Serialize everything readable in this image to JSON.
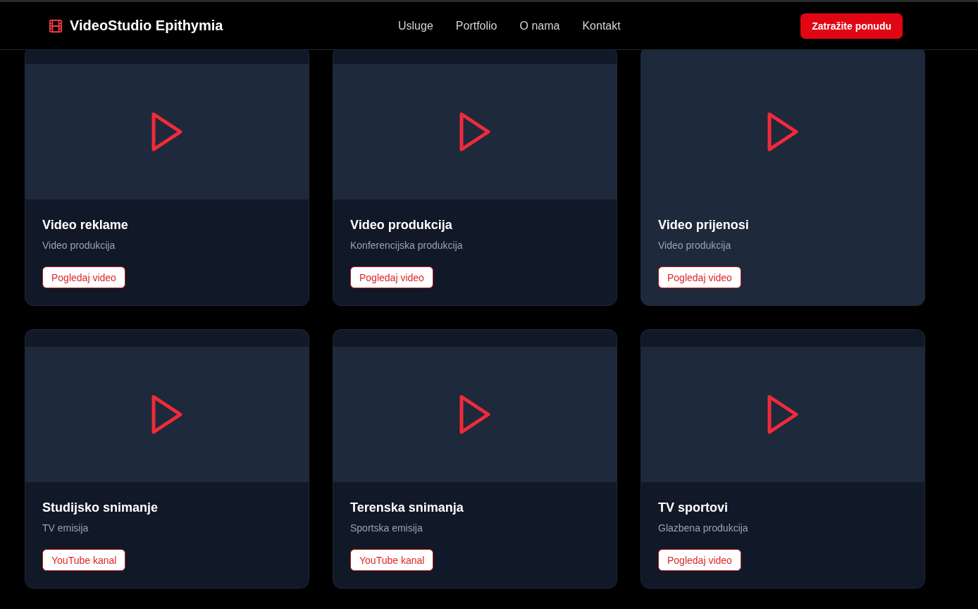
{
  "header": {
    "logo": "VideoStudio Epithymia",
    "nav": [
      "Usluge",
      "Portfolio",
      "O nama",
      "Kontakt"
    ],
    "cta": "Zatražite ponudu"
  },
  "cards": [
    {
      "title": "Video reklame",
      "subtitle": "Video produkcija",
      "button": "Pogledaj video",
      "highlighted": false
    },
    {
      "title": "Video produkcija",
      "subtitle": "Konferencijska produkcija",
      "button": "Pogledaj video",
      "highlighted": false
    },
    {
      "title": "Video prijenosi",
      "subtitle": "Video produkcija",
      "button": "Pogledaj video",
      "highlighted": true
    },
    {
      "title": "Studijsko snimanje",
      "subtitle": "TV emisija",
      "button": "YouTube kanal",
      "highlighted": false
    },
    {
      "title": "Terenska snimanja",
      "subtitle": "Sportska emisija",
      "button": "YouTube kanal",
      "highlighted": false
    },
    {
      "title": "TV sportovi",
      "subtitle": "Glazbena produkcija",
      "button": "Pogledaj video",
      "highlighted": false
    }
  ]
}
